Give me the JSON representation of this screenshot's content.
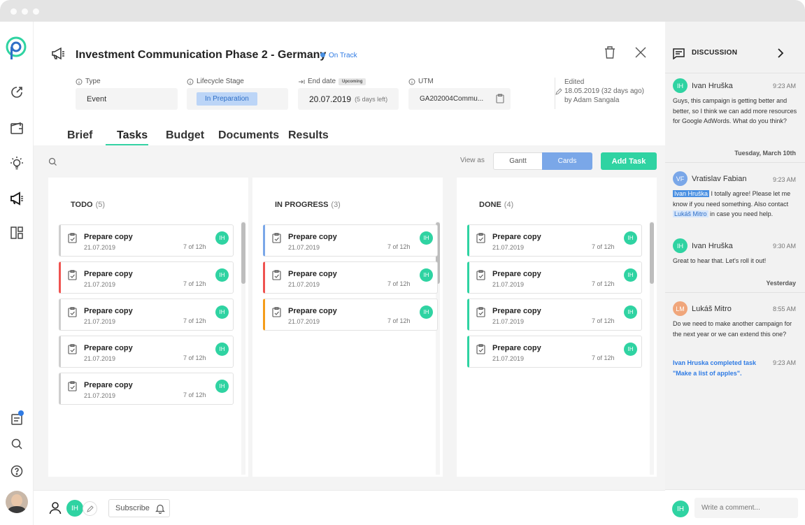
{
  "project": {
    "title": "Investment Communication Phase 2 - Germany",
    "status": "On Track"
  },
  "fields": {
    "type": {
      "label": "Type",
      "value": "Event"
    },
    "lifecycle": {
      "label": "Lifecycle Stage",
      "value": "In Preparation"
    },
    "end_date": {
      "label": "End date",
      "badge": "Upcoming",
      "value": "20.07.2019",
      "note": "(5 days left)"
    },
    "utm": {
      "label": "UTM",
      "value": "GA202004Commu..."
    },
    "edited": {
      "label": "Edited",
      "date": "18.05.2019 (32 days ago)",
      "by": "by Adam Sangala"
    }
  },
  "tabs": [
    "Brief",
    "Tasks",
    "Budget",
    "Documents",
    "Results"
  ],
  "toolbar": {
    "view_as": "View as",
    "gantt": "Gantt",
    "cards": "Cards",
    "add_task": "Add Task"
  },
  "columns": [
    {
      "title": "TODO",
      "count": "(5)",
      "cards": [
        {
          "title": "Prepare copy",
          "date": "21.07.2019",
          "hours": "7 of 12h",
          "avatar": "IH",
          "color": "#cfcfcf"
        },
        {
          "title": "Prepare copy",
          "date": "21.07.2019",
          "hours": "7 of 12h",
          "avatar": "IH",
          "color": "#ef5350"
        },
        {
          "title": "Prepare copy",
          "date": "21.07.2019",
          "hours": "7 of 12h",
          "avatar": "IH",
          "color": "#cfcfcf"
        },
        {
          "title": "Prepare copy",
          "date": "21.07.2019",
          "hours": "7 of 12h",
          "avatar": "IH",
          "color": "#cfcfcf"
        },
        {
          "title": "Prepare copy",
          "date": "21.07.2019",
          "hours": "7 of 12h",
          "avatar": "IH",
          "color": "#cfcfcf"
        }
      ]
    },
    {
      "title": "IN PROGRESS",
      "count": "(3)",
      "cards": [
        {
          "title": "Prepare copy",
          "date": "21.07.2019",
          "hours": "7 of 12h",
          "avatar": "IH",
          "color": "#7aa7e8"
        },
        {
          "title": "Prepare copy",
          "date": "21.07.2019",
          "hours": "7 of 12h",
          "avatar": "IH",
          "color": "#ef5350"
        },
        {
          "title": "Prepare copy",
          "date": "21.07.2019",
          "hours": "7 of 12h",
          "avatar": "IH",
          "color": "#f59d1a"
        }
      ]
    },
    {
      "title": "DONE",
      "count": "(4)",
      "cards": [
        {
          "title": "Prepare copy",
          "date": "21.07.2019",
          "hours": "7 of 12h",
          "avatar": "IH",
          "color": "#2fd3a2"
        },
        {
          "title": "Prepare copy",
          "date": "21.07.2019",
          "hours": "7 of 12h",
          "avatar": "IH",
          "color": "#2fd3a2"
        },
        {
          "title": "Prepare copy",
          "date": "21.07.2019",
          "hours": "7 of 12h",
          "avatar": "IH",
          "color": "#2fd3a2"
        },
        {
          "title": "Prepare copy",
          "date": "21.07.2019",
          "hours": "7 of 12h",
          "avatar": "IH",
          "color": "#2fd3a2"
        }
      ]
    }
  ],
  "footer": {
    "avatar": "IH",
    "subscribe": "Subscribe"
  },
  "discussion": {
    "title": "DISCUSSION",
    "m1": {
      "initials": "IH",
      "name": "Ivan Hruška",
      "time": "9:23 AM",
      "text": "Guys, this campaign is getting better and better, so I think we can add more resources for Google AdWords. What do you think?"
    },
    "date1": "Tuesday, March 10th",
    "m2": {
      "initials": "VF",
      "name": "Vratislav Fabian",
      "time": "9:23 AM",
      "mention1": "Ivan Hruška",
      "text1": " I totally agree! Please let me know if you need something. Also contact ",
      "mention2": "Lukáš Mitro",
      "text2": " in case you need help."
    },
    "m3": {
      "initials": "IH",
      "name": "Ivan Hruška",
      "time": "9:30 AM",
      "text": "Great to hear that. Let's roll it out!"
    },
    "date2": "Yesterday",
    "m4": {
      "initials": "LM",
      "name": "Lukáš Mitro",
      "time": "8:55 AM",
      "text": "Do we need to make another campaign for the next year or we can extend this one?"
    },
    "activity": {
      "text": "Ivan Hruska completed task \"Make a list of apples\".",
      "time": "9:23 AM"
    },
    "footer": {
      "avatar": "IH",
      "placeholder": "Write a comment..."
    }
  },
  "colors": {
    "accent": "#2fd3a2",
    "blue": "#4a90e2",
    "on_track": "#2f7be4"
  }
}
